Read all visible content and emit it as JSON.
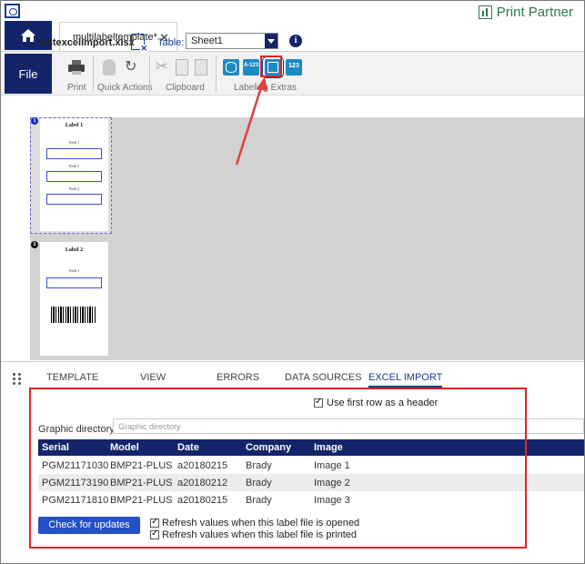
{
  "app": {
    "brand": "Print Partner"
  },
  "document_tab": {
    "label": "multilabeltemplate*",
    "close": "✕"
  },
  "ribbon": {
    "file_label": "File",
    "groups": {
      "print": "Print",
      "quick_actions": "Quick Actions",
      "clipboard": "Clipboard",
      "labeling_extras": "Labeling Extras"
    },
    "icon_texts": {
      "serialize": "A-123",
      "counter": "123"
    }
  },
  "canvas": {
    "labels": [
      {
        "badge": "1",
        "title": "Label 1",
        "fields": [
          "Field 1",
          "Field 2",
          "Field 3"
        ]
      },
      {
        "badge": "2",
        "title": "Label 2",
        "fields": [
          "Field 1"
        ]
      }
    ]
  },
  "panel_tabs": [
    {
      "label": "TEMPLATE"
    },
    {
      "label": "VIEW"
    },
    {
      "label": "ERRORS"
    },
    {
      "label": "DATA SOURCES"
    },
    {
      "label": "EXCEL IMPORT",
      "active": true
    }
  ],
  "excel_import": {
    "file_name": "testexcelimport.xlsx",
    "table_label": "Table:",
    "selected_sheet": "Sheet1",
    "info_icon": "i",
    "use_header_label": "Use first row as a header",
    "graphic_dir_label": "Graphic directory:",
    "graphic_dir_placeholder": "Graphic directory",
    "columns": [
      "Serial",
      "Model",
      "Date",
      "Company",
      "Image"
    ],
    "rows": [
      [
        "PGM21171030",
        "BMP21-PLUS",
        "a20180215",
        "Brady",
        "Image 1"
      ],
      [
        "PGM21173190",
        "BMP21-PLUS",
        "a20180212",
        "Brady",
        "Image 2"
      ],
      [
        "PGM21171810",
        "BMP21-PLUS",
        "a20180215",
        "Brady",
        "Image 3"
      ]
    ],
    "check_button": "Check for updates",
    "refresh_opened": "Refresh values when this label file is opened",
    "refresh_printed": "Refresh values when this label file is printed"
  },
  "colors": {
    "navy": "#14246b",
    "accent_blue": "#2450c8",
    "annotation_red": "#e02424",
    "brand_green": "#2f7a4a"
  }
}
